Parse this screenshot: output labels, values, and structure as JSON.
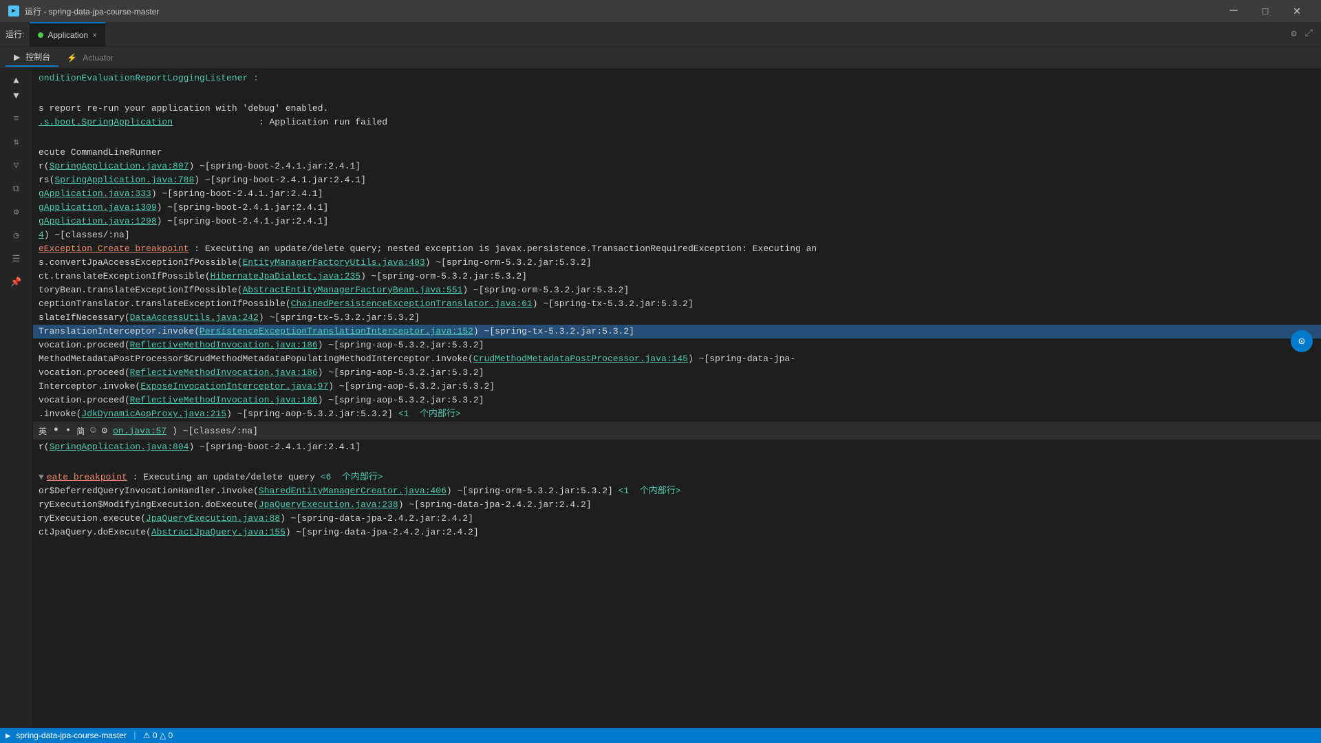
{
  "window": {
    "title": "运行 - spring-data-jpa-course-master",
    "icon": "▶"
  },
  "titlebar": {
    "text": "运行 - spring-data-jpa-course-master",
    "minimize": "─",
    "maximize": "□",
    "close": "✕"
  },
  "runbar": {
    "label": "运行:",
    "tab_label": "Application",
    "close_icon": "×"
  },
  "secondarybar": {
    "btn1": "控制台",
    "btn2": "Actuator"
  },
  "sidebar": {
    "icons": [
      "▶",
      "⏹",
      "↺",
      "⚡",
      "📋",
      "🔧",
      "📊",
      "⭐"
    ]
  },
  "console": {
    "lines": [
      {
        "text": "onditionEvaluationReportLoggingListener :",
        "type": "cyan"
      },
      {
        "text": "",
        "type": "normal"
      },
      {
        "text": "s report re-run your application with 'debug' enabled.",
        "type": "normal"
      },
      {
        "text": ".s.boot.SpringApplication                : Application run failed",
        "type": "normal",
        "link": ".s.boot.SpringApplication",
        "linkTarget": "SpringApplication"
      },
      {
        "text": "",
        "type": "normal"
      },
      {
        "text": "ecute CommandLineRunner",
        "type": "normal"
      },
      {
        "text": "r(SpringApplication.java:807) ~[spring-boot-2.4.1.jar:2.4.1]",
        "type": "normal",
        "link": "SpringApplication.java:807"
      },
      {
        "text": "rs(SpringApplication.java:788) ~[spring-boot-2.4.1.jar:2.4.1]",
        "type": "normal",
        "link": "SpringApplication.java:788"
      },
      {
        "text": "gApplication.java:333) ~[spring-boot-2.4.1.jar:2.4.1]",
        "type": "normal",
        "link": "gApplication.java:333"
      },
      {
        "text": "gApplication.java:1309) ~[spring-boot-2.4.1.jar:2.4.1]",
        "type": "normal",
        "link": "gApplication.java:1309"
      },
      {
        "text": "gApplication.java:1298) ~[spring-boot-2.4.1.jar:2.4.1]",
        "type": "normal",
        "link": "gApplication.java:1298"
      },
      {
        "text": "4) ~[classes/:na]",
        "type": "normal",
        "link": "4"
      },
      {
        "text": "eException Create breakpoint  : Executing an update/delete query; nested exception is javax.persistence.TransactionRequiredException: Executing an",
        "type": "error",
        "breakpoint": "Create breakpoint"
      },
      {
        "text": "s.convertJpaAccessExceptionIfPossible(EntityManagerFactoryUtils.java:403) ~[spring-orm-5.3.2.jar:5.3.2]",
        "type": "normal",
        "link": "EntityManagerFactoryUtils.java:403"
      },
      {
        "text": "ct.translateExceptionIfPossible(HibernateJpaDialect.java:235) ~[spring-orm-5.3.2.jar:5.3.2]",
        "type": "normal",
        "link": "HibernateJpaDialect.java:235"
      },
      {
        "text": "toryBean.translateExceptionIfPossible(AbstractEntityManagerFactoryBean.java:551) ~[spring-orm-5.3.2.jar:5.3.2]",
        "type": "normal",
        "link": "AbstractEntityManagerFactoryBean.java:551"
      },
      {
        "text": "ceptionTranslator.translateExceptionIfPossible(ChainedPersistenceExceptionTranslator.java:61) ~[spring-tx-5.3.2.jar:5.3.2]",
        "type": "normal",
        "link": "ChainedPersistenceExceptionTranslator.java:61"
      },
      {
        "text": "slateIfNecessary(DataAccessUtils.java:242) ~[spring-tx-5.3.2.jar:5.3.2]",
        "type": "normal",
        "link": "DataAccessUtils.java:242"
      },
      {
        "text": "TranslationInterceptor.invoke(PersistenceExceptionTranslationInterceptor.java:152) ~[spring-tx-5.3.2.jar:5.3.2]",
        "type": "normal",
        "link": "PersistenceExceptionTranslationInterceptor.java:152",
        "highlighted": true
      },
      {
        "text": "vocation.proceed(ReflectiveMethodInvocation.java:186) ~[spring-aop-5.3.2.jar:5.3.2]",
        "type": "normal",
        "link": "ReflectiveMethodInvocation.java:186"
      },
      {
        "text": "MethodMetadataPostProcessor$CrudMethodMetadataPopulatingMethodInterceptor.invoke(CrudMethodMetadataPostProcessor.java:145) ~[spring-data-jpa-",
        "type": "normal",
        "link": "CrudMethodMetadataPostProcessor.java:145"
      },
      {
        "text": "vocation.proceed(ReflectiveMethodInvocation.java:186) ~[spring-aop-5.3.2.jar:5.3.2]",
        "type": "normal",
        "link": "ReflectiveMethodInvocation.java:186"
      },
      {
        "text": "Interceptor.invoke(ExposeInvocationInterceptor.java:97) ~[spring-aop-5.3.2.jar:5.3.2]",
        "type": "normal",
        "link": "ExposeInvocationInterceptor.java:97"
      },
      {
        "text": "vocation.proceed(ReflectiveMethodInvocation.java:186) ~[spring-aop-5.3.2.jar:5.3.2]",
        "type": "normal",
        "link": "ReflectiveMethodInvocation.java:186"
      },
      {
        "text": ".invoke(JdkDynamicAopProxy.java:215) ~[spring-aop-5.3.2.jar:5.3.2] <1  个内部行>",
        "type": "normal",
        "link": "JdkDynamicAopProxy.java:215",
        "internal": "<1  个内部行>"
      },
      {
        "text": ".invoke(on.java:57) ~[classes/:na]",
        "type": "normal",
        "link": "on.java:57"
      },
      {
        "text": "r(SpringApplication.java:804) ~[spring-boot-2.4.1.jar:2.4.1]",
        "type": "normal",
        "link": "SpringApplication.java:804"
      },
      {
        "text": "",
        "type": "normal"
      },
      {
        "text": "eate breakpoint  : Executing an update/delete query <6  个内部行>",
        "type": "error",
        "breakpoint": "eate breakpoint"
      },
      {
        "text": "or$DeferredQueryInvocationHandler.invoke(SharedEntityManagerCreator.java:406) ~[spring-orm-5.3.2.jar:5.3.2] <1  个内部行>",
        "type": "normal",
        "link": "SharedEntityManagerCreator.java:406",
        "internal2": "<1  个内部行>"
      },
      {
        "text": "ryExecution$ModifyingExecution.doExecute(JpaQueryExecution.java:238) ~[spring-data-jpa-2.4.2.jar:2.4.2]",
        "type": "normal",
        "link": "JpaQueryExecution.java:238"
      },
      {
        "text": "ryExecution.execute(JpaQueryExecution.java:88) ~[spring-data-jpa-2.4.2.jar:2.4.2]",
        "type": "normal",
        "link": "JpaQueryExecution.java:88"
      },
      {
        "text": "ctJpaQuery.doExecute(AbstractJpaQuery.java:155) ~[spring-data-jpa-2.4.2.jar:2.4.2]",
        "type": "normal",
        "link": "AbstractJpaQuery.java:155"
      }
    ]
  },
  "statusbar": {
    "lang_indicator": "英",
    "loading": "•",
    "lang2": "简",
    "smile": "☺",
    "settings": "⚙"
  }
}
